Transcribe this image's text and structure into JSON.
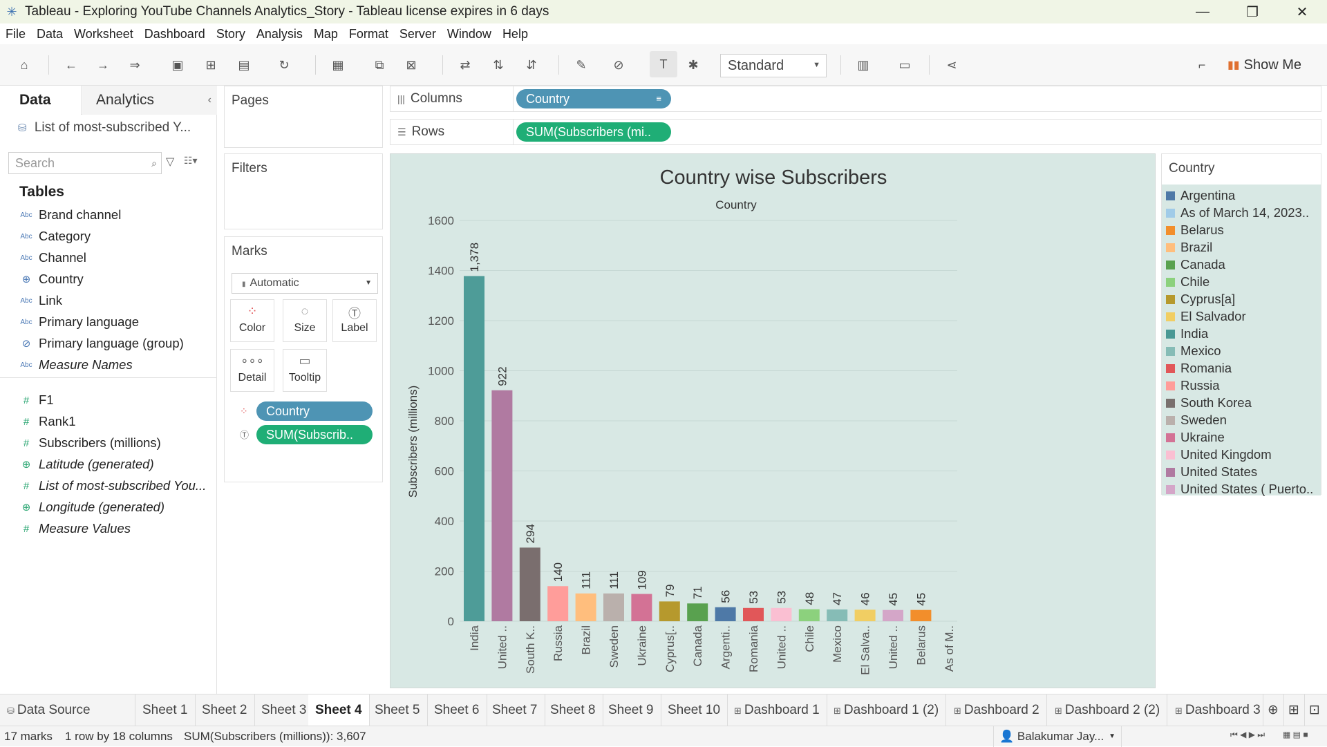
{
  "window": {
    "title": "Tableau - Exploring YouTube Channels Analytics_Story - Tableau license expires in 6 days",
    "minimize": "—",
    "restore": "❐",
    "close": "✕"
  },
  "menu": [
    "File",
    "Data",
    "Worksheet",
    "Dashboard",
    "Story",
    "Analysis",
    "Map",
    "Format",
    "Server",
    "Window",
    "Help"
  ],
  "toolbar": {
    "view_size": "Standard",
    "show_me": "Show Me"
  },
  "left_pane": {
    "tab_data": "Data",
    "tab_analytics": "Analytics",
    "collapse": "‹",
    "datasource": "List of most-subscribed Y...",
    "search_placeholder": "Search",
    "tables_label": "Tables",
    "dimensions": [
      {
        "label": "Brand channel",
        "icon": "Abc"
      },
      {
        "label": "Category",
        "icon": "Abc"
      },
      {
        "label": "Channel",
        "icon": "Abc"
      },
      {
        "label": "Country",
        "icon": "⊕"
      },
      {
        "label": "Link",
        "icon": "Abc"
      },
      {
        "label": "Primary language",
        "icon": "Abc"
      },
      {
        "label": "Primary language (group)",
        "icon": "⊘"
      },
      {
        "label": "Measure Names",
        "icon": "Abc"
      }
    ],
    "measures": [
      {
        "label": "F1",
        "icon": "#"
      },
      {
        "label": "Rank1",
        "icon": "#"
      },
      {
        "label": "Subscribers (millions)",
        "icon": "#"
      },
      {
        "label": "Latitude (generated)",
        "icon": "⊕"
      },
      {
        "label": "List of most-subscribed You...",
        "icon": "#"
      },
      {
        "label": "Longitude (generated)",
        "icon": "⊕"
      },
      {
        "label": "Measure Values",
        "icon": "#"
      }
    ]
  },
  "cards": {
    "pages": "Pages",
    "filters": "Filters",
    "marks": "Marks",
    "mark_type": "Automatic",
    "mark_buttons": [
      "Color",
      "Size",
      "Label",
      "Detail",
      "Tooltip"
    ],
    "mark_pills": [
      "Country",
      "SUM(Subscrib.."
    ]
  },
  "shelves": {
    "columns_label": "Columns",
    "columns_pill": "Country",
    "rows_label": "Rows",
    "rows_pill": "SUM(Subscribers (mi.."
  },
  "chart_data": {
    "type": "bar",
    "title": "Country wise Subscribers",
    "subtitle": "Country",
    "ylabel": "Subscribers (millions)",
    "ylim": [
      0,
      1600
    ],
    "yticks": [
      0,
      200,
      400,
      600,
      800,
      1000,
      1200,
      1400,
      1600
    ],
    "grid": true,
    "categories": [
      "India",
      "United ..",
      "South K..",
      "Russia",
      "Brazil",
      "Sweden",
      "Ukraine",
      "Cyprus[..",
      "Canada",
      "Argenti..",
      "Romania",
      "United ..",
      "Chile",
      "Mexico",
      "El Salva..",
      "United ..",
      "Belarus",
      "As of M.."
    ],
    "values": [
      1378,
      922,
      294,
      140,
      111,
      111,
      109,
      79,
      71,
      56,
      53,
      53,
      48,
      47,
      46,
      45,
      45,
      null
    ],
    "labels": [
      "1,378",
      "922",
      "294",
      "140",
      "111",
      "111",
      "109",
      "79",
      "71",
      "56",
      "53",
      "53",
      "48",
      "47",
      "46",
      "45",
      "45",
      ""
    ],
    "colors": [
      "#4e9c98",
      "#b07aa1",
      "#7a6e6e",
      "#ff9d9a",
      "#ffbe7d",
      "#bab0ac",
      "#d37295",
      "#b6992d",
      "#59a14f",
      "#4e79a7",
      "#e15759",
      "#fabfd2",
      "#8cd17d",
      "#86bcb6",
      "#f1ce63",
      "#d4a6c8",
      "#f28e2b",
      "#a0cbe8"
    ]
  },
  "legend": {
    "title": "Country",
    "items": [
      {
        "label": "Argentina",
        "color": "#4e79a7"
      },
      {
        "label": "As of March 14, 2023..",
        "color": "#a0cbe8"
      },
      {
        "label": "Belarus",
        "color": "#f28e2b"
      },
      {
        "label": "Brazil",
        "color": "#ffbe7d"
      },
      {
        "label": "Canada",
        "color": "#59a14f"
      },
      {
        "label": "Chile",
        "color": "#8cd17d"
      },
      {
        "label": "Cyprus[a]",
        "color": "#b6992d"
      },
      {
        "label": "El Salvador",
        "color": "#f1ce63"
      },
      {
        "label": "India",
        "color": "#499894"
      },
      {
        "label": "Mexico",
        "color": "#86bcb6"
      },
      {
        "label": "Romania",
        "color": "#e15759"
      },
      {
        "label": "Russia",
        "color": "#ff9d9a"
      },
      {
        "label": "South Korea",
        "color": "#79706e"
      },
      {
        "label": "Sweden",
        "color": "#bab0ac"
      },
      {
        "label": "Ukraine",
        "color": "#d37295"
      },
      {
        "label": "United Kingdom",
        "color": "#fabfd2"
      },
      {
        "label": "United States",
        "color": "#b07aa1"
      },
      {
        "label": "United States ( Puerto..",
        "color": "#d4a6c8"
      }
    ]
  },
  "sheet_tabs": {
    "datasource": "Data Source",
    "sheets": [
      "Sheet 1",
      "Sheet 2",
      "Sheet 3",
      "Sheet 4",
      "Sheet 5",
      "Sheet 6",
      "Sheet 7",
      "Sheet 8",
      "Sheet 9",
      "Sheet 10"
    ],
    "dashboards": [
      "Dashboard 1",
      "Dashboard 1 (2)",
      "Dashboard 2",
      "Dashboard 2 (2)",
      "Dashboard 3"
    ],
    "active": "Sheet 4"
  },
  "status": {
    "marks": "17 marks",
    "dims": "1 row by 18 columns",
    "sum": "SUM(Subscribers (millions)): 3,607",
    "user": "Balakumar Jay..."
  }
}
